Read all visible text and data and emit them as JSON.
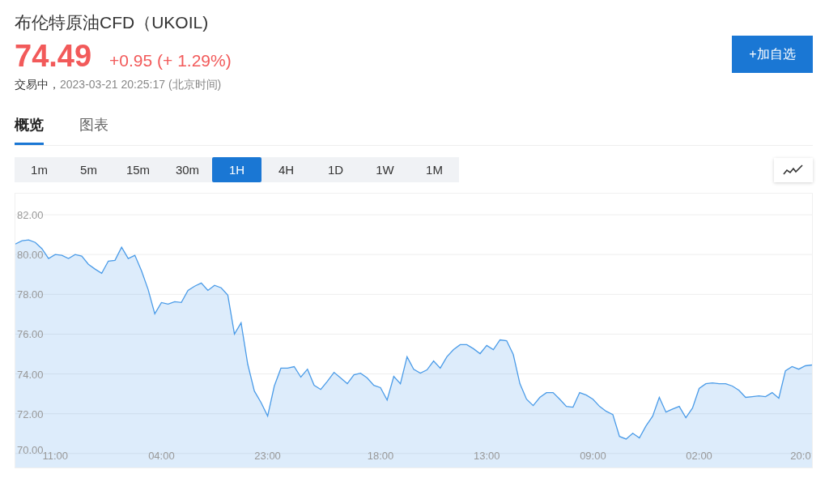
{
  "instrument": {
    "title": "布伦特原油CFD（UKOIL)",
    "price": "74.49",
    "change": "+0.95 (+ 1.29%)",
    "status": "交易中，",
    "timestamp": "2023-03-21 20:25:17 (北京时间)"
  },
  "add_button": "+加自选",
  "tabs": [
    {
      "label": "概览",
      "selected": true
    },
    {
      "label": "图表",
      "selected": false
    }
  ],
  "periods": [
    {
      "label": "1m",
      "selected": false
    },
    {
      "label": "5m",
      "selected": false
    },
    {
      "label": "15m",
      "selected": false
    },
    {
      "label": "30m",
      "selected": false
    },
    {
      "label": "1H",
      "selected": true
    },
    {
      "label": "4H",
      "selected": false
    },
    {
      "label": "1D",
      "selected": false
    },
    {
      "label": "1W",
      "selected": false
    },
    {
      "label": "1M",
      "selected": false
    }
  ],
  "chart_data": {
    "type": "area",
    "categories": [
      null,
      null,
      null,
      null,
      null,
      null,
      "11:00",
      null,
      null,
      null,
      null,
      null,
      null,
      null,
      null,
      null,
      null,
      null,
      null,
      null,
      null,
      null,
      "04:00",
      null,
      null,
      null,
      null,
      null,
      null,
      null,
      null,
      null,
      null,
      null,
      null,
      null,
      null,
      null,
      "23:00",
      null,
      null,
      null,
      null,
      null,
      null,
      null,
      null,
      null,
      null,
      null,
      null,
      null,
      null,
      null,
      null,
      "18:00",
      null,
      null,
      null,
      null,
      null,
      null,
      null,
      null,
      null,
      null,
      null,
      null,
      null,
      null,
      null,
      "13:00",
      null,
      null,
      null,
      null,
      null,
      null,
      null,
      null,
      null,
      null,
      null,
      null,
      null,
      null,
      null,
      "09:00",
      null,
      null,
      null,
      null,
      null,
      null,
      null,
      null,
      null,
      null,
      null,
      null,
      null,
      null,
      null,
      "02:00",
      null,
      null,
      null,
      null,
      null,
      null,
      null,
      null,
      null,
      null,
      null,
      null,
      null,
      null,
      null,
      "20:0",
      null
    ],
    "series": [
      {
        "color": "#4a9be8",
        "values": [
          80.53,
          80.69,
          80.73,
          80.61,
          80.29,
          79.8,
          80.0,
          79.96,
          79.8,
          80.0,
          79.92,
          79.51,
          79.27,
          79.06,
          79.67,
          79.71,
          80.37,
          79.8,
          79.96,
          79.18,
          78.24,
          77.02,
          77.59,
          77.51,
          77.63,
          77.59,
          78.2,
          78.41,
          78.57,
          78.2,
          78.45,
          78.33,
          77.96,
          76.0,
          76.57,
          74.49,
          73.14,
          72.57,
          71.88,
          73.39,
          74.29,
          74.29,
          74.37,
          73.84,
          74.24,
          73.43,
          73.22,
          73.63,
          74.08,
          73.8,
          73.51,
          73.96,
          74.04,
          73.8,
          73.43,
          73.31,
          72.69,
          73.88,
          73.51,
          74.86,
          74.24,
          74.04,
          74.2,
          74.65,
          74.29,
          74.86,
          75.22,
          75.47,
          75.47,
          75.27,
          75.02,
          75.43,
          75.22,
          75.71,
          75.67,
          74.98,
          73.51,
          72.73,
          72.41,
          72.82,
          73.06,
          73.06,
          72.73,
          72.37,
          72.33,
          73.06,
          72.94,
          72.73,
          72.37,
          72.12,
          71.96,
          70.86,
          70.73,
          71.02,
          70.78,
          71.39,
          71.88,
          72.82,
          72.08,
          72.24,
          72.37,
          71.8,
          72.29,
          73.27,
          73.51,
          73.55,
          73.51,
          73.51,
          73.39,
          73.18,
          72.82,
          72.86,
          72.9,
          72.86,
          73.06,
          72.78,
          74.16,
          74.37,
          74.24,
          74.41,
          74.45
        ]
      }
    ],
    "ylim": [
      69.3,
      83.06
    ],
    "grid": true,
    "yticks": [
      {
        "value": 70,
        "label": "70.00"
      },
      {
        "value": 72,
        "label": "72.00"
      },
      {
        "value": 74,
        "label": "74.00"
      },
      {
        "value": 76,
        "label": "76.00"
      },
      {
        "value": 78,
        "label": "78.00"
      },
      {
        "value": 80,
        "label": "80.00"
      },
      {
        "value": 82,
        "label": "82.00"
      }
    ]
  }
}
